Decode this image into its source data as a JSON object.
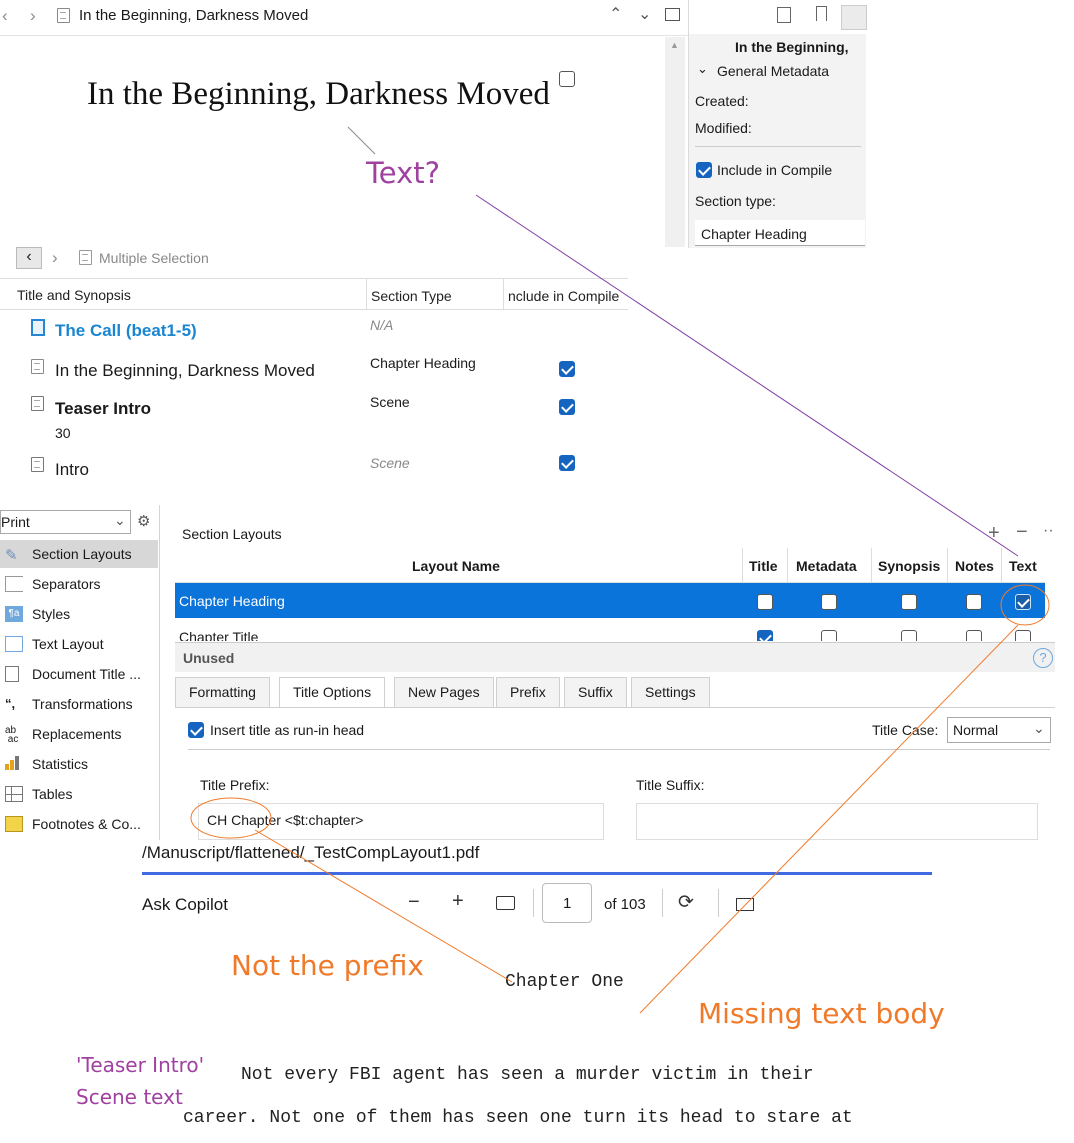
{
  "editor": {
    "title": "In the Beginning, Darkness Moved",
    "heading": "In the Beginning, Darkness Moved"
  },
  "inspector": {
    "title": "In the Beginning,",
    "section": "General Metadata",
    "created_label": "Created:",
    "modified_label": "Modified:",
    "include_label": "Include in Compile",
    "section_type_label": "Section type:",
    "section_type_value": "Chapter Heading"
  },
  "outline": {
    "title": "Multiple Selection",
    "headers": {
      "title": "Title and Synopsis",
      "type": "Section Type",
      "include": "nclude in Compile"
    },
    "rows": [
      {
        "title": "The Call (beat1-5)",
        "type": "N/A",
        "include": false
      },
      {
        "title": "In the Beginning, Darkness Moved",
        "type": "Chapter Heading",
        "include": true
      },
      {
        "title": "Teaser Intro",
        "synopsis": "30",
        "type": "Scene",
        "include": true
      },
      {
        "title": "Intro",
        "type": "Scene",
        "include": true
      }
    ]
  },
  "compile": {
    "format": "Print",
    "sidebar": [
      {
        "label": "Section Layouts",
        "icon": "brush-icon",
        "selected": true
      },
      {
        "label": "Separators",
        "icon": "separator-icon"
      },
      {
        "label": "Styles",
        "icon": "styles-icon"
      },
      {
        "label": "Text Layout",
        "icon": "text-layout-icon"
      },
      {
        "label": "Document Title ...",
        "icon": "document-title-icon"
      },
      {
        "label": "Transformations",
        "icon": "transformations-icon"
      },
      {
        "label": "Replacements",
        "icon": "replacements-icon"
      },
      {
        "label": "Statistics",
        "icon": "statistics-icon"
      },
      {
        "label": "Tables",
        "icon": "tables-icon"
      },
      {
        "label": "Footnotes & Co...",
        "icon": "footnotes-icon"
      }
    ],
    "layouts_label": "Section Layouts",
    "columns": [
      "Layout Name",
      "Title",
      "Metadata",
      "Synopsis",
      "Notes",
      "Text"
    ],
    "layouts": [
      {
        "name": "Chapter Heading",
        "title": false,
        "metadata": false,
        "synopsis": false,
        "notes": false,
        "text": true,
        "selected": true
      },
      {
        "name": "Chapter Title",
        "title": true,
        "metadata": false,
        "synopsis": false,
        "notes": false,
        "text": false
      }
    ],
    "unused_label": "Unused",
    "tabs": [
      "Formatting",
      "Title Options",
      "New Pages",
      "Prefix",
      "Suffix",
      "Settings"
    ],
    "active_tab": "Title Options",
    "run_in_label": "Insert title as run-in head",
    "title_case_label": "Title Case:",
    "title_case_value": "Normal",
    "prefix_label": "Title Prefix:",
    "prefix_value": "CH Chapter <$t:chapter>",
    "suffix_label": "Title Suffix:"
  },
  "pdf": {
    "path": "/Manuscript/flattened/_TestCompLayout1.pdf",
    "ask": "Ask Copilot",
    "page": "1",
    "of": "of 103",
    "chapter": "Chapter One",
    "body1": "Not every FBI agent has seen a murder victim in their",
    "body2": "career.  Not one of them has seen one turn its head to stare at"
  },
  "annotations": {
    "text_q": "Text?",
    "not_prefix": "Not the prefix",
    "missing": "Missing text body",
    "teaser1": "'Teaser Intro'",
    "teaser2": "Scene text"
  },
  "colors": {
    "accent": "#1565c0",
    "selection": "#0a74da",
    "purple": "#a040a0",
    "orange": "#f07a2a"
  }
}
